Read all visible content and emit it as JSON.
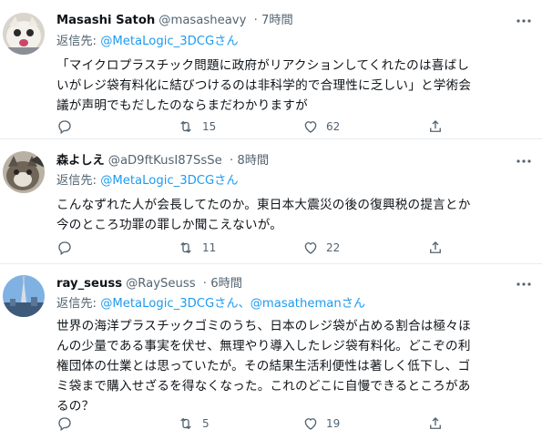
{
  "tweets": [
    {
      "name": "Masashi Satoh",
      "handle": "@masasheavy",
      "time": "7時間",
      "reply_prefix": "返信先: ",
      "mentions": "@MetaLogic_3DCG",
      "mention_suffix": "さん",
      "lines": [
        "「マイクロプラスチック問題に政府がリアクションしてくれたのは喜ばし",
        "いがレジ袋有料化に結びつけるのは非科学的で合理性に乏しい」と学術会",
        "議が声明でもだしたのならまだわかりますが"
      ],
      "retweets": "15",
      "likes": "62"
    },
    {
      "name": "森よしえ",
      "handle": "@aD9ftKusI87SsSe",
      "time": "8時間",
      "reply_prefix": "返信先: ",
      "mentions": "@MetaLogic_3DCG",
      "mention_suffix": "さん",
      "lines": [
        "こんなずれた人が会長してたのか。東日本大震災の後の復興税の提言とか",
        "今のところ功罪の罪しか聞こえないが。"
      ],
      "retweets": "11",
      "likes": "22"
    },
    {
      "name": "ray_seuss",
      "handle": "@RaySeuss",
      "time": "6時間",
      "reply_prefix": "返信先: ",
      "mentions": "@MetaLogic_3DCG",
      "mention_suffix": "さん、",
      "mentions2": "@masathemanさん",
      "lines": [
        "世界の海洋プラスチックゴミのうち、日本のレジ袋が占める割合は極々ほ",
        "んの少量である事実を伏せ、無理やり導入したレジ袋有料化。どこぞの利",
        "権団体の仕業とは思っていたが。その結果生活利便性は著しく低下し、ゴ",
        "ミ袋まで購入せざるを得なくなった。これのどこに自慢できるところがあ",
        "るの？"
      ],
      "retweets": "5",
      "likes": "19"
    }
  ],
  "icons": {
    "reply": "reply-icon",
    "retweet": "retweet-icon",
    "like": "heart-icon",
    "share": "share-icon",
    "more": "more-icon"
  },
  "colors": {
    "text": "#0f1419",
    "secondary": "#536471",
    "mention": "#1d9bf0",
    "divider": "#e6ecf0"
  }
}
